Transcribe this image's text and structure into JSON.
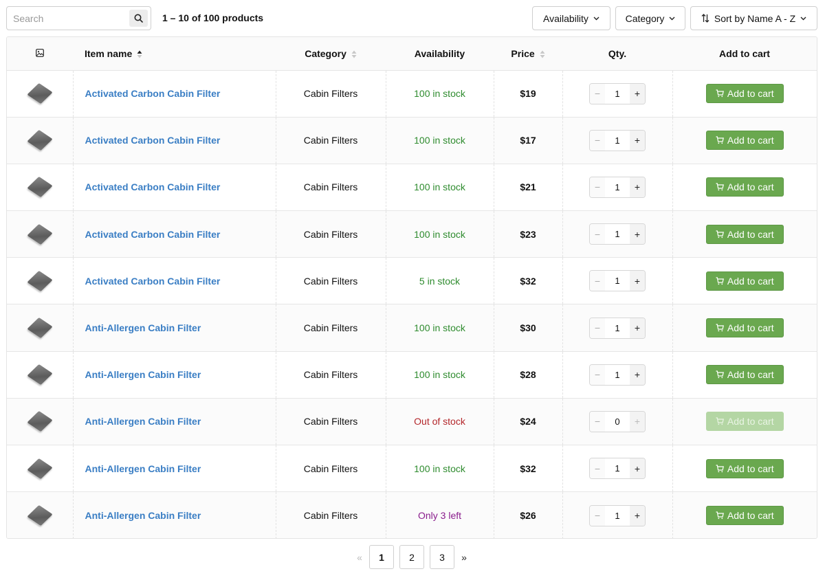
{
  "search": {
    "placeholder": "Search",
    "value": ""
  },
  "summary": "1 – 10 of 100 products",
  "filters": {
    "availability": "Availability",
    "category": "Category",
    "sort": "Sort by Name A - Z"
  },
  "columns": {
    "item_name": "Item name",
    "category": "Category",
    "availability": "Availability",
    "price": "Price",
    "qty": "Qty.",
    "add_to_cart": "Add to cart"
  },
  "colors": {
    "link": "#3a7ec4",
    "in_stock": "#2e8b2e",
    "out_of_stock": "#b3262a",
    "low_stock": "#8a1c8c",
    "cart_button": "#6aa84f"
  },
  "rows": [
    {
      "name": "Activated Carbon Cabin Filter",
      "category": "Cabin Filters",
      "availability": "100 in stock",
      "status": "in",
      "price": "$19",
      "qty": "1",
      "button": "Add to cart",
      "enabled": true
    },
    {
      "name": "Activated Carbon Cabin Filter",
      "category": "Cabin Filters",
      "availability": "100 in stock",
      "status": "in",
      "price": "$17",
      "qty": "1",
      "button": "Add to cart",
      "enabled": true
    },
    {
      "name": "Activated Carbon Cabin Filter",
      "category": "Cabin Filters",
      "availability": "100 in stock",
      "status": "in",
      "price": "$21",
      "qty": "1",
      "button": "Add to cart",
      "enabled": true
    },
    {
      "name": "Activated Carbon Cabin Filter",
      "category": "Cabin Filters",
      "availability": "100 in stock",
      "status": "in",
      "price": "$23",
      "qty": "1",
      "button": "Add to cart",
      "enabled": true
    },
    {
      "name": "Activated Carbon Cabin Filter",
      "category": "Cabin Filters",
      "availability": "5 in stock",
      "status": "in",
      "price": "$32",
      "qty": "1",
      "button": "Add to cart",
      "enabled": true
    },
    {
      "name": "Anti-Allergen Cabin Filter",
      "category": "Cabin Filters",
      "availability": "100 in stock",
      "status": "in",
      "price": "$30",
      "qty": "1",
      "button": "Add to cart",
      "enabled": true
    },
    {
      "name": "Anti-Allergen Cabin Filter",
      "category": "Cabin Filters",
      "availability": "100 in stock",
      "status": "in",
      "price": "$28",
      "qty": "1",
      "button": "Add to cart",
      "enabled": true
    },
    {
      "name": "Anti-Allergen Cabin Filter",
      "category": "Cabin Filters",
      "availability": "Out of stock",
      "status": "out",
      "price": "$24",
      "qty": "0",
      "button": "Add to cart",
      "enabled": false
    },
    {
      "name": "Anti-Allergen Cabin Filter",
      "category": "Cabin Filters",
      "availability": "100 in stock",
      "status": "in",
      "price": "$32",
      "qty": "1",
      "button": "Add to cart",
      "enabled": true
    },
    {
      "name": "Anti-Allergen Cabin Filter",
      "category": "Cabin Filters",
      "availability": "Only 3 left",
      "status": "low",
      "price": "$26",
      "qty": "1",
      "button": "Add to cart",
      "enabled": true
    }
  ],
  "pagination": {
    "prev": "«",
    "pages": [
      "1",
      "2",
      "3"
    ],
    "current": "1",
    "next": "»"
  }
}
